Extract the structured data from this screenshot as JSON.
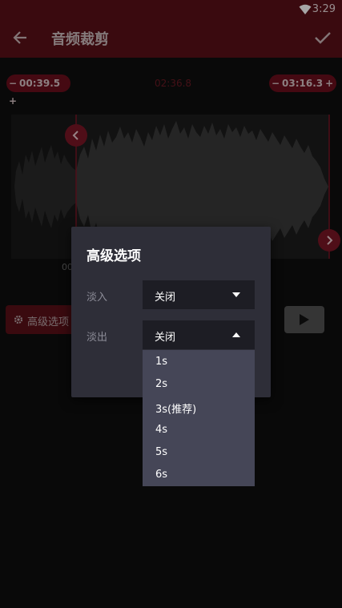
{
  "status_bar": {
    "time": "3:29",
    "wifi_icon": "wifi-icon"
  },
  "app_bar": {
    "title": "音频裁剪",
    "back_icon": "back-arrow-icon",
    "confirm_icon": "check-icon"
  },
  "trim": {
    "start": {
      "minus": "−",
      "value": "00:39.5",
      "plus": "+"
    },
    "end": {
      "minus": "−",
      "value": "03:16.3",
      "plus": "+"
    },
    "duration": "02:36.8",
    "waveform_time_label": "00"
  },
  "controls": {
    "advanced_button_label": "高级选项",
    "gear_icon": "gear-icon",
    "play_icon": "play-icon"
  },
  "dialog": {
    "title": "高级选项",
    "fade_in": {
      "label": "淡入",
      "value": "关闭"
    },
    "fade_out": {
      "label": "淡出",
      "value": "关闭"
    }
  },
  "dropdown": {
    "options": [
      "1s",
      "2s",
      "3s(推荐)",
      "4s",
      "5s",
      "6s"
    ]
  },
  "colors": {
    "accent": "#5a1018",
    "pill": "#6a0f1c",
    "dialog_bg": "#2e2e38",
    "select_bg": "#1d1d24",
    "dropdown_bg": "#454657"
  }
}
